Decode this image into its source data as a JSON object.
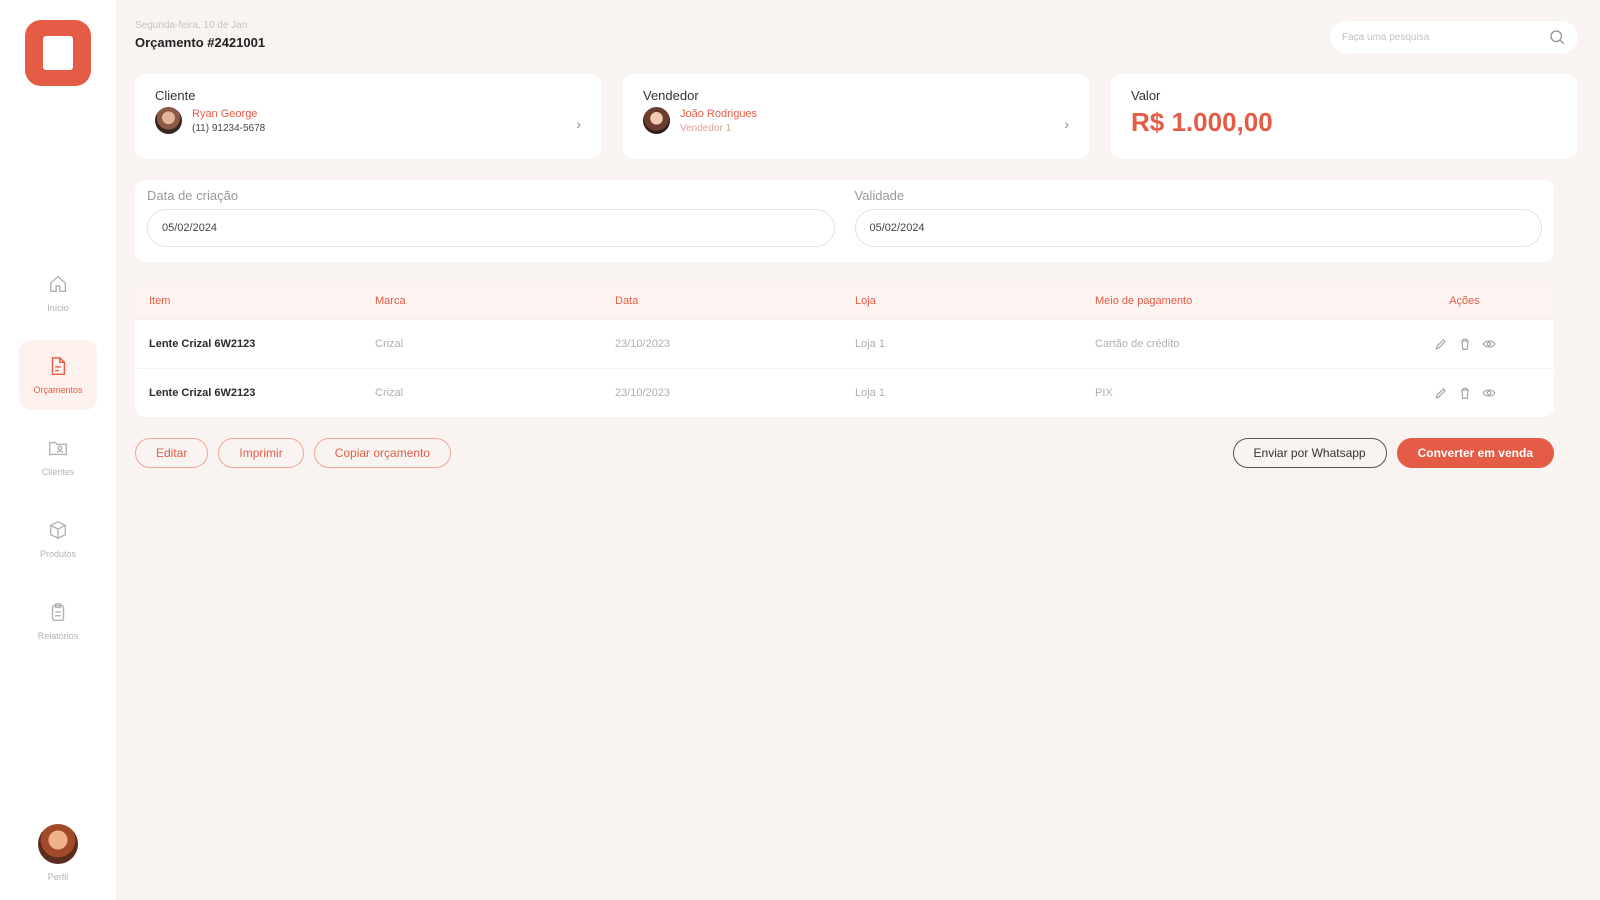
{
  "sidebar": {
    "nav": [
      {
        "label": "Início",
        "icon": "home-icon"
      },
      {
        "label": "Orçamentos",
        "icon": "document-icon"
      },
      {
        "label": "Clientes",
        "icon": "folder-user-icon"
      },
      {
        "label": "Produtos",
        "icon": "box-icon"
      },
      {
        "label": "Relatórios",
        "icon": "clipboard-icon"
      }
    ],
    "profile_label": "Perfil"
  },
  "header": {
    "crumb": "Segunda-feira, 10 de Jan",
    "title": "Orçamento #2421001"
  },
  "search": {
    "placeholder": "Faça uma pesquisa"
  },
  "cards": {
    "client": {
      "title": "Cliente",
      "name": "Ryan George",
      "sub": "(11) 91234-5678"
    },
    "seller": {
      "title": "Vendedor",
      "name": "João Rodrigues",
      "sub": "Vendedor 1"
    },
    "value": {
      "title": "Valor",
      "amount": "R$ 1.000,00"
    }
  },
  "dates": {
    "created_label": "Data de criação",
    "created_value": "05/02/2024",
    "validity_label": "Validade",
    "validity_value": "05/02/2024"
  },
  "table": {
    "headers": [
      "Item",
      "Marca",
      "Data",
      "Loja",
      "Meio de pagamento",
      "Ações"
    ],
    "rows": [
      [
        "Lente Crizal 6W2123",
        "Crizal",
        "23/10/2023",
        "Loja 1",
        "Cartão de crédito"
      ],
      [
        "Lente Crizal 6W2123",
        "Crizal",
        "23/10/2023",
        "Loja 1",
        "PIX"
      ]
    ]
  },
  "buttons": {
    "edit": "Editar",
    "print": "Imprimir",
    "copy": "Copiar orçamento",
    "whatsapp": "Enviar por Whatsapp",
    "convert": "Converter em venda"
  },
  "colors": {
    "accent": "#e45c45",
    "background": "#f9f3f1"
  }
}
